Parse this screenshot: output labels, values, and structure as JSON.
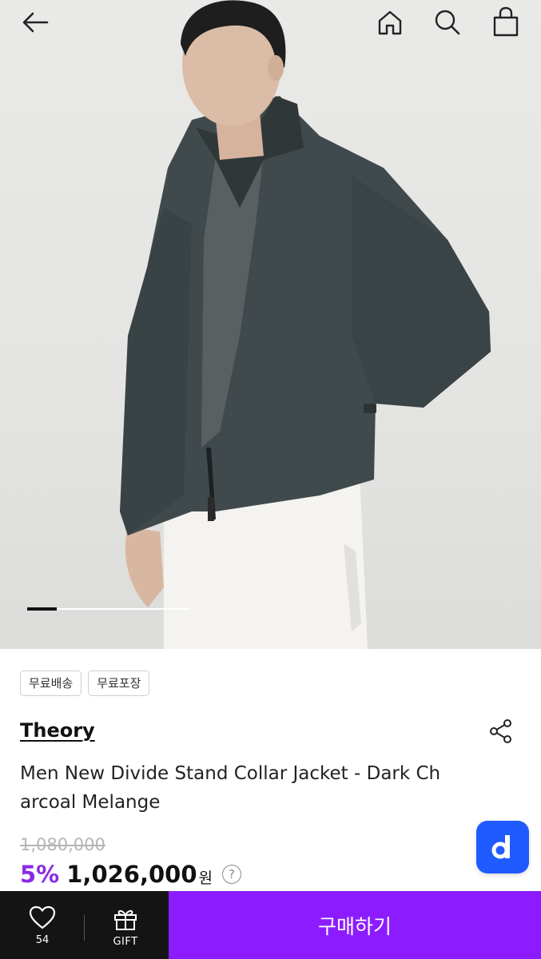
{
  "header": {
    "back_icon": "arrow-left-icon",
    "home_icon": "home-icon",
    "search_icon": "search-icon",
    "cart_icon": "shopping-bag-icon"
  },
  "gallery": {
    "progress": 0.18
  },
  "tags": [
    "무료배송",
    "무료포장"
  ],
  "product": {
    "brand": "Theory",
    "title": "Men New Divide Stand Collar Jacket - Dark Charcoal Melange",
    "original_price": "1,080,000",
    "discount": "5%",
    "sale_price": "1,026,000",
    "currency": "원",
    "help_symbol": "?"
  },
  "fab": {
    "label": "d"
  },
  "bottom_bar": {
    "wishlist_count": "54",
    "gift_label": "GIFT",
    "buy_label": "구매하기"
  },
  "colors": {
    "accent": "#8c1cff",
    "discount": "#8a2be2",
    "fab": "#1f5bff",
    "bottom_dark": "#141414"
  }
}
